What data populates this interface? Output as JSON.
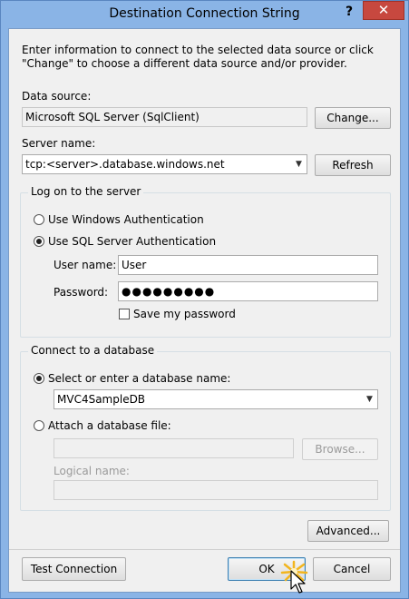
{
  "window": {
    "title": "Destination Connection String",
    "help_label": "?",
    "close_label": "✕"
  },
  "intro_text": "Enter information to connect to the selected data source or click \"Change\" to choose a different data source and/or provider.",
  "data_source": {
    "label": "Data source:",
    "value": "Microsoft SQL Server (SqlClient)",
    "change_label": "Change..."
  },
  "server": {
    "label": "Server name:",
    "value": "tcp:<server>.database.windows.net",
    "refresh_label": "Refresh"
  },
  "logon": {
    "group_label": "Log on to the server",
    "windows_auth_label": "Use Windows Authentication",
    "sql_auth_label": "Use SQL Server Authentication",
    "selected": "sql",
    "username_label": "User name:",
    "username_value": "User",
    "password_label": "Password:",
    "password_value": "●●●●●●●●●",
    "save_password_label": "Save my password",
    "save_password_checked": false
  },
  "database": {
    "group_label": "Connect to a database",
    "select_label": "Select or enter a database name:",
    "db_value": "MVC4SampleDB",
    "attach_label": "Attach a database file:",
    "attach_value": "",
    "browse_label": "Browse...",
    "logical_name_label": "Logical name:",
    "logical_name_value": ""
  },
  "advanced_label": "Advanced...",
  "footer": {
    "test_label": "Test Connection",
    "ok_label": "OK",
    "cancel_label": "Cancel"
  },
  "icons": {
    "combo_arrow": "chevron-down-icon",
    "cursor": "mouse-pointer-icon"
  }
}
